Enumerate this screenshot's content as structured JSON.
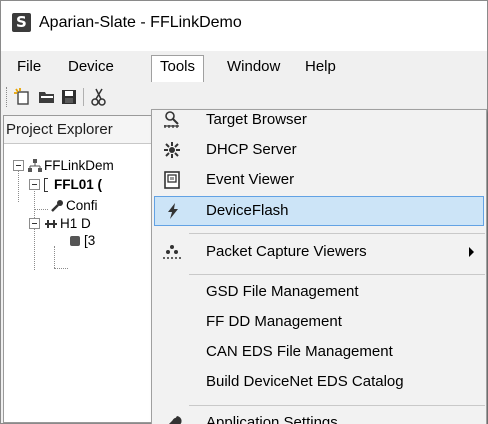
{
  "window": {
    "title": "Aparian-Slate  - FFLinkDemo",
    "logo_letter": "S"
  },
  "menubar": {
    "items": [
      {
        "label": "File"
      },
      {
        "label": "Device"
      },
      {
        "label": "Tools"
      },
      {
        "label": "Window"
      },
      {
        "label": "Help"
      }
    ],
    "open_menu": "Tools"
  },
  "toolbar": {
    "icons": [
      "new-icon",
      "open-icon",
      "save-icon",
      "cut-icon"
    ]
  },
  "explorer": {
    "title": "Project Explorer",
    "tree": [
      {
        "label": "FFLinkDem"
      },
      {
        "label": "FFL01 ("
      },
      {
        "label": "Confi"
      },
      {
        "label": "H1 D"
      },
      {
        "label": "[3"
      }
    ]
  },
  "tools_menu": {
    "items": [
      {
        "label": "Target Browser",
        "icon": "target-browser-icon"
      },
      {
        "label": "DHCP Server",
        "icon": "dhcp-server-icon"
      },
      {
        "label": "Event Viewer",
        "icon": "event-viewer-icon"
      },
      {
        "label": "DeviceFlash",
        "icon": "device-flash-icon",
        "highlighted": true
      },
      {
        "label": "Packet Capture Viewers",
        "icon": "packet-capture-icon",
        "has_submenu": true
      },
      {
        "label": "GSD File Management"
      },
      {
        "label": "FF DD Management"
      },
      {
        "label": "CAN EDS File Management"
      },
      {
        "label": "Build DeviceNet EDS Catalog"
      },
      {
        "label": "Application Settings",
        "icon": "wrench-icon"
      }
    ]
  },
  "colors": {
    "highlight_fill": "#cce4f7",
    "highlight_border": "#62a2e4",
    "menu_background": "#f2f2f2",
    "mdi_background": "#a8a8a8"
  }
}
